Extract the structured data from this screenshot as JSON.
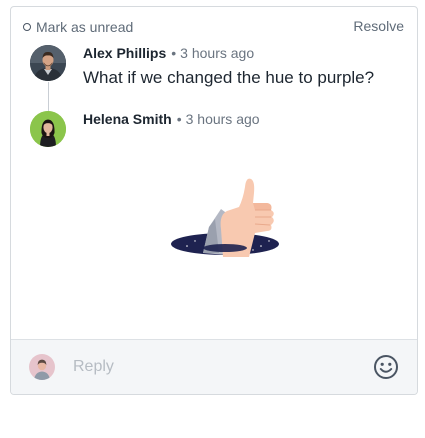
{
  "topbar": {
    "mark_unread_label": "Mark as unread",
    "resolve_label": "Resolve"
  },
  "comments": [
    {
      "author": "Alex Phillips",
      "separator": "•",
      "time": "3 hours ago",
      "body": "What if we changed the hue to purple?",
      "avatar_color": "#3b4652"
    },
    {
      "author": "Helena Smith",
      "separator": "•",
      "time": "3 hours ago",
      "avatar_color": "#8bc54b"
    }
  ],
  "illustration": {
    "icon": "thumbs-up-hole-illustration"
  },
  "reply": {
    "placeholder": "Reply",
    "value": "",
    "emoji_icon": "smiley-face-icon"
  },
  "colors": {
    "border": "#d6dade",
    "reply_bg": "#f4f6f8",
    "text_primary": "#1d2630",
    "text_secondary": "#6a7480"
  }
}
